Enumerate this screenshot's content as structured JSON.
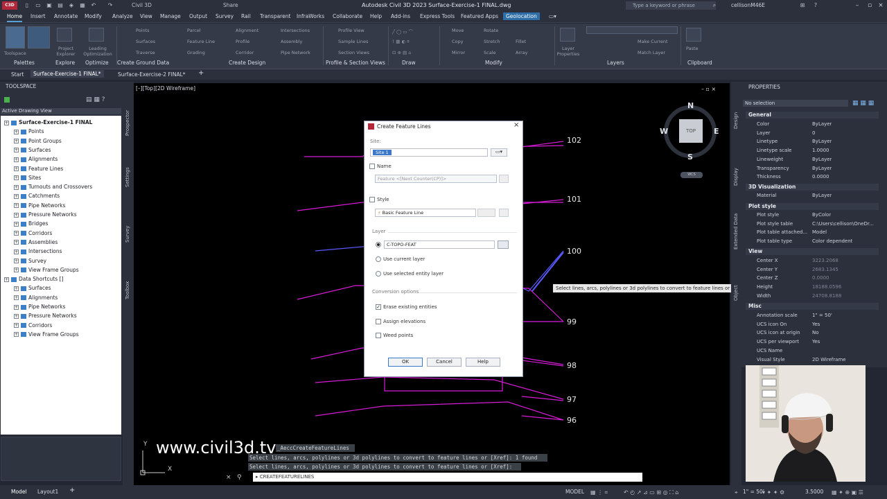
{
  "titlebar": {
    "app_badge": "C3D",
    "file_label": "Civil 3D",
    "share_label": "Share",
    "title": "Autodesk Civil 3D 2023   Surface-Exercise-1 FINAL.dwg",
    "search_placeholder": "Type a keyword or phrase",
    "user": "cellisonM46E"
  },
  "menu_tabs": [
    "Home",
    "Insert",
    "Annotate",
    "Modify",
    "Analyze",
    "View",
    "Manage",
    "Output",
    "Survey",
    "Rail",
    "Transparent",
    "InfraWorks",
    "Collaborate",
    "Help",
    "Add-ins",
    "Express Tools",
    "Featured Apps",
    "Geolocation"
  ],
  "ribbon": {
    "buttons": {
      "toolspace": "Toolspace",
      "project_explorer": "Project Explorer",
      "leading_opt": "Leading Optimization",
      "points": "Points",
      "surfaces": "Surfaces",
      "traverse": "Traverse",
      "parcel": "Parcel",
      "feature_line": "Feature Line",
      "grading": "Grading",
      "alignment": "Alignment",
      "profile": "Profile",
      "corridor": "Corridor",
      "intersections": "Intersections",
      "assembly": "Assembly",
      "pipe_network": "Pipe Network",
      "profile_view": "Profile View",
      "sample_lines": "Sample Lines",
      "section_views": "Section Views",
      "move": "Move",
      "copy": "Copy",
      "mirror": "Mirror",
      "rotate": "Rotate",
      "stretch": "Stretch",
      "scale": "Scale",
      "fillet": "Fillet",
      "array": "Array",
      "layer_properties": "Layer Properties",
      "make_current": "Make Current",
      "match_layer": "Match Layer",
      "paste": "Paste"
    },
    "panels": {
      "palettes": "Palettes",
      "explore": "Explore",
      "optimize": "Optimize",
      "create_ground": "Create Ground Data",
      "create_design": "Create Design",
      "profile_section": "Profile & Section Views",
      "draw": "Draw",
      "modify": "Modify",
      "layers": "Layers",
      "clipboard": "Clipboard"
    }
  },
  "doc_tabs": [
    "Start",
    "Surface-Exercise-1 FINAL*",
    "Surface-Exercise-2 FINAL*"
  ],
  "toolspace": {
    "header": "TOOLSPACE",
    "dropdown": "Active Drawing View",
    "tree": [
      {
        "label": "Surface-Exercise-1 FINAL",
        "level": 0,
        "bold": true
      },
      {
        "label": "Points",
        "level": 1
      },
      {
        "label": "Point Groups",
        "level": 1
      },
      {
        "label": "Surfaces",
        "level": 1
      },
      {
        "label": "Alignments",
        "level": 1
      },
      {
        "label": "Feature Lines",
        "level": 1
      },
      {
        "label": "Sites",
        "level": 1
      },
      {
        "label": "Turnouts and Crossovers",
        "level": 1
      },
      {
        "label": "Catchments",
        "level": 1
      },
      {
        "label": "Pipe Networks",
        "level": 1
      },
      {
        "label": "Pressure Networks",
        "level": 1
      },
      {
        "label": "Bridges",
        "level": 1
      },
      {
        "label": "Corridors",
        "level": 1
      },
      {
        "label": "Assemblies",
        "level": 1
      },
      {
        "label": "Intersections",
        "level": 1
      },
      {
        "label": "Survey",
        "level": 1
      },
      {
        "label": "View Frame Groups",
        "level": 1
      },
      {
        "label": "Data Shortcuts []",
        "level": 0
      },
      {
        "label": "Surfaces",
        "level": 1
      },
      {
        "label": "Alignments",
        "level": 1
      },
      {
        "label": "Pipe Networks",
        "level": 1
      },
      {
        "label": "Pressure Networks",
        "level": 1
      },
      {
        "label": "Corridors",
        "level": 1
      },
      {
        "label": "View Frame Groups",
        "level": 1
      }
    ]
  },
  "side_labels": {
    "left": [
      "Prospector",
      "Settings",
      "Survey",
      "Toolbox"
    ],
    "right": [
      "Design",
      "Display",
      "Extended Data",
      "Object"
    ]
  },
  "canvas": {
    "view_label": "[–][Top][2D Wireframe]",
    "contour_labels": [
      "102",
      "101",
      "100",
      "99",
      "98",
      "97",
      "96"
    ],
    "compass": {
      "n": "N",
      "s": "S",
      "e": "E",
      "w": "W",
      "cube": "TOP",
      "wcs": "WCS"
    },
    "tooltip": "Select lines, arcs, polylines or 3d polylines to convert to feature lines or",
    "watermark": "www.civil3d.tv"
  },
  "command_line": {
    "history": [
      "_AeccCreateFeatureLines",
      "Select lines, arcs, polylines or 3d polylines to convert to feature lines or [Xref]: 1 found",
      "Select lines, arcs, polylines or 3d polylines to convert to feature lines or [Xref]:"
    ],
    "input": "CREATEFEATURELINES"
  },
  "dialog": {
    "title": "Create Feature Lines",
    "site_label": "Site:",
    "site_value": "Site 1",
    "name_label": "Name",
    "name_value": "Feature <[Next Counter(CP)]>",
    "style_label": "Style",
    "style_value": "Basic Feature Line",
    "layer_label": "Layer",
    "layer_value": "C-TOPO-FEAT",
    "use_current_layer": "Use current layer",
    "use_selected_layer": "Use selected entity layer",
    "conversion_label": "Conversion options",
    "erase_existing": "Erase existing entities",
    "assign_elevations": "Assign elevations",
    "weed_points": "Weed points",
    "ok": "OK",
    "cancel": "Cancel",
    "help": "Help"
  },
  "properties": {
    "header": "PROPERTIES",
    "selection": "No selection",
    "sections": {
      "general": "General",
      "visualization": "3D Visualization",
      "plot_style": "Plot style",
      "view": "View",
      "misc": "Misc"
    },
    "general": [
      {
        "k": "Color",
        "v": "ByLayer"
      },
      {
        "k": "Layer",
        "v": "0"
      },
      {
        "k": "Linetype",
        "v": "ByLayer"
      },
      {
        "k": "Linetype scale",
        "v": "1.0000"
      },
      {
        "k": "Lineweight",
        "v": "ByLayer"
      },
      {
        "k": "Transparency",
        "v": "ByLayer"
      },
      {
        "k": "Thickness",
        "v": "0.0000"
      }
    ],
    "visualization": [
      {
        "k": "Material",
        "v": "ByLayer"
      }
    ],
    "plot": [
      {
        "k": "Plot style",
        "v": "ByColor"
      },
      {
        "k": "Plot style table",
        "v": "C:\\Users\\cellison\\OneDr..."
      },
      {
        "k": "Plot table attached...",
        "v": "Model"
      },
      {
        "k": "Plot table type",
        "v": "Color dependent"
      }
    ],
    "view": [
      {
        "k": "Center X",
        "v": "3223.2068"
      },
      {
        "k": "Center Y",
        "v": "2683.1345"
      },
      {
        "k": "Center Z",
        "v": "0.0000"
      },
      {
        "k": "Height",
        "v": "18188.0596"
      },
      {
        "k": "Width",
        "v": "24708.8188"
      }
    ],
    "misc": [
      {
        "k": "Annotation scale",
        "v": "1\" = 50'"
      },
      {
        "k": "UCS icon On",
        "v": "Yes"
      },
      {
        "k": "UCS icon at origin",
        "v": "No"
      },
      {
        "k": "UCS per viewport",
        "v": "Yes"
      },
      {
        "k": "UCS Name",
        "v": ""
      },
      {
        "k": "Visual Style",
        "v": "2D Wireframe"
      }
    ]
  },
  "status": {
    "model_tab": "Model",
    "layout_tab": "Layout1",
    "model_label": "MODEL",
    "scale": "1\" = 50'",
    "value": "3.5000"
  },
  "colors": {
    "contour_magenta": "#d81cd8",
    "contour_blue": "#5a5aff",
    "accent": "#2d6da8"
  }
}
